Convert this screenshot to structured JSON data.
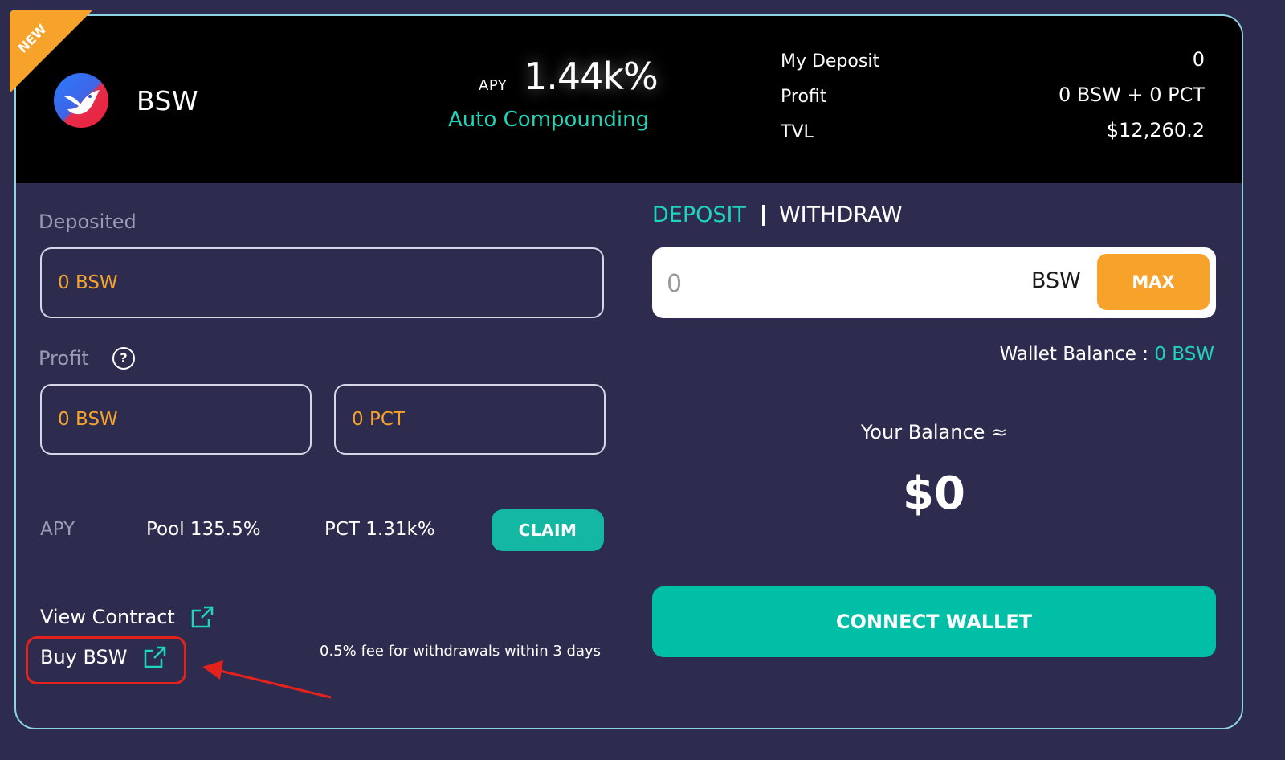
{
  "badge": {
    "text": "NEW"
  },
  "pool": {
    "token": "BSW",
    "apy_label": "APY",
    "apy_value": "1.44k%",
    "strategy": "Auto Compounding"
  },
  "stats": [
    {
      "label": "My Deposit",
      "value": "0"
    },
    {
      "label": "Profit",
      "value": "0 BSW + 0 PCT"
    },
    {
      "label": "TVL",
      "value": "$12,260.2"
    }
  ],
  "deposited": {
    "label": "Deposited",
    "value": "0 BSW"
  },
  "profit": {
    "label": "Profit",
    "help_icon": "question-circle-icon",
    "bsw_value": "0 BSW",
    "pct_value": "0 PCT"
  },
  "apy_breakdown": {
    "label": "APY",
    "pool": "Pool 135.5%",
    "pct": "PCT 1.31k%",
    "claim_label": "CLAIM"
  },
  "links": {
    "view_contract": "View Contract",
    "buy": "Buy BSW",
    "icon": "external-link-icon"
  },
  "fee_note": "0.5% fee for withdrawals within 3 days",
  "tabs": {
    "deposit": "DEPOSIT",
    "withdraw": "WITHDRAW"
  },
  "amount": {
    "placeholder": "0",
    "unit": "BSW",
    "max_label": "MAX"
  },
  "wallet_balance": {
    "label": "Wallet Balance :",
    "value": "0 BSW"
  },
  "your_balance": {
    "label": "Your Balance ≈",
    "value": "$0"
  },
  "connect_label": "CONNECT WALLET",
  "colors": {
    "background": "#2d2c4e",
    "accent_teal": "#1ed5b9",
    "accent_orange": "#f7a22a",
    "annotation_red": "#e3221d"
  }
}
